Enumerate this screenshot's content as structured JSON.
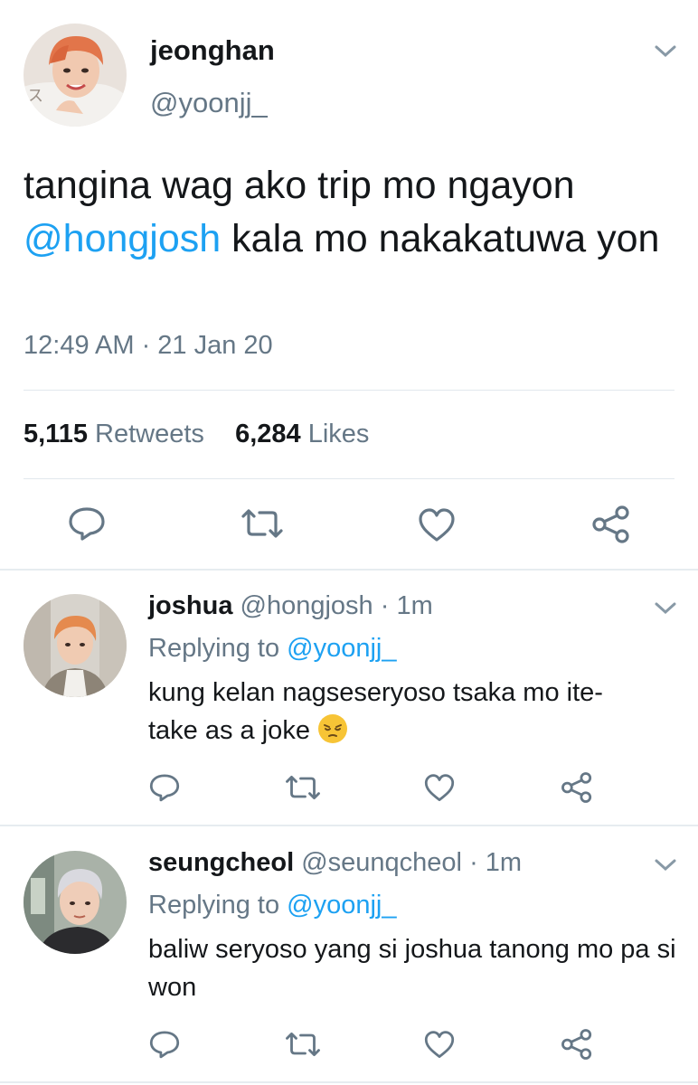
{
  "main_tweet": {
    "avatar_icon": "avatar-jeonghan",
    "display_name": "jeonghan",
    "handle": "@yoonjj_",
    "text_part1": "tangina wag ako trip mo ngayon ",
    "mention": "@hongjosh",
    "text_part2": " kala mo nakakatuwa yon",
    "timestamp": "12:49 AM · 21 Jan 20",
    "retweets_count": "5,115",
    "retweets_label": "Retweets",
    "likes_count": "6,284",
    "likes_label": "Likes",
    "actions": [
      "reply-icon",
      "retweet-icon",
      "like-icon",
      "share-icon"
    ]
  },
  "replies": [
    {
      "display_name": "joshua",
      "handle": "@hongjosh",
      "time": "· 1m",
      "replying_label": "Replying to",
      "replying_to": "@yoonjj_",
      "text": "kung kelan nagseseryoso tsaka mo ite-take as a joke",
      "emoji": "pensive-face-emoji"
    },
    {
      "display_name": "seungcheol",
      "handle": "@seunqcheol",
      "time": "· 1m",
      "replying_label": "Replying to",
      "replying_to": "@yoonjj_",
      "text": "baliw seryoso yang si joshua tanong mo pa si won"
    }
  ],
  "colors": {
    "link": "#1da1f2",
    "muted": "#657786",
    "text": "#14171a",
    "divider": "#e1e8ed"
  }
}
